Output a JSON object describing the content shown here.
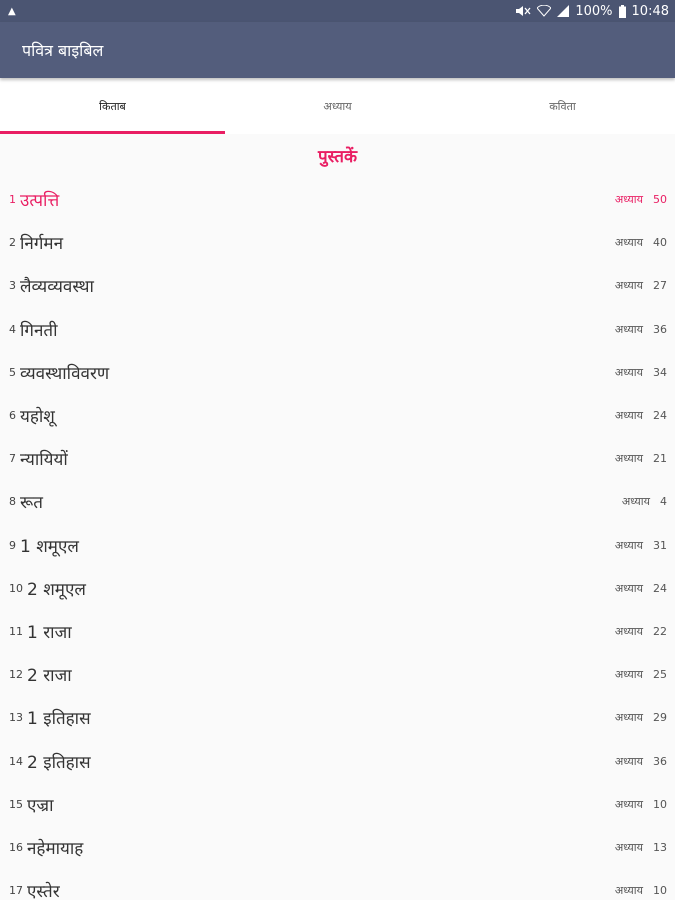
{
  "statusbar": {
    "battery": "100%",
    "time": "10:48"
  },
  "toolbar": {
    "title": "पवित्र बाइबिल"
  },
  "tabs": [
    {
      "label": "किताब",
      "active": true
    },
    {
      "label": "अध्याय",
      "active": false
    },
    {
      "label": "कविता",
      "active": false
    }
  ],
  "section": {
    "title": "पुस्तकें"
  },
  "chapter_label": "अध्याय",
  "accent_color": "#e91e63",
  "books": [
    {
      "num": "1",
      "name": "उत्पत्ति",
      "chapters": "50",
      "highlight": true
    },
    {
      "num": "2",
      "name": "निर्गमन",
      "chapters": "40"
    },
    {
      "num": "3",
      "name": "लैव्यव्यवस्था",
      "chapters": "27"
    },
    {
      "num": "4",
      "name": "गिनती",
      "chapters": "36"
    },
    {
      "num": "5",
      "name": "व्यवस्थाविवरण",
      "chapters": "34"
    },
    {
      "num": "6",
      "name": "यहोशू",
      "chapters": "24"
    },
    {
      "num": "7",
      "name": "न्यायियों",
      "chapters": "21"
    },
    {
      "num": "8",
      "name": "रूत",
      "chapters": "4"
    },
    {
      "num": "9",
      "name": "1 शमूएल",
      "chapters": "31"
    },
    {
      "num": "10",
      "name": "2 शमूएल",
      "chapters": "24"
    },
    {
      "num": "11",
      "name": "1 राजा",
      "chapters": "22"
    },
    {
      "num": "12",
      "name": "2 राजा",
      "chapters": "25"
    },
    {
      "num": "13",
      "name": "1 इतिहास",
      "chapters": "29"
    },
    {
      "num": "14",
      "name": "2 इतिहास",
      "chapters": "36"
    },
    {
      "num": "15",
      "name": "एज्रा",
      "chapters": "10"
    },
    {
      "num": "16",
      "name": "नहेमायाह",
      "chapters": "13"
    },
    {
      "num": "17",
      "name": "एस्तेर",
      "chapters": "10"
    }
  ]
}
